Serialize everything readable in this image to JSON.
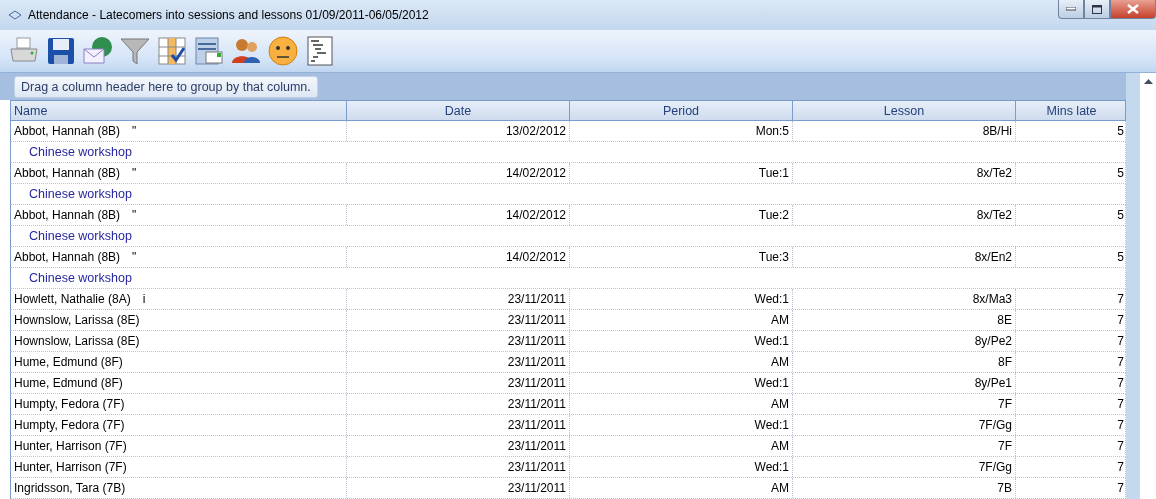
{
  "window": {
    "title": "Attendance - Latecomers into sessions and lessons 01/09/2011-06/05/2012"
  },
  "toolbar": [
    {
      "kind": "printer"
    },
    {
      "kind": "save"
    },
    {
      "kind": "email"
    },
    {
      "kind": "filter"
    },
    {
      "kind": "columns"
    },
    {
      "kind": "export"
    },
    {
      "kind": "people"
    },
    {
      "kind": "face"
    },
    {
      "kind": "report"
    }
  ],
  "group_panel": {
    "hint": "Drag a column header here to group by that column."
  },
  "table": {
    "columns": [
      "Name",
      "Date",
      "Period",
      "Lesson",
      "Mins late"
    ],
    "rows": [
      {
        "name": "Abbot, Hannah (8B)",
        "mark": "\"",
        "date": "13/02/2012",
        "period": "Mon:5",
        "lesson": "8B/Hi",
        "mins": "5",
        "note": "Chinese workshop"
      },
      {
        "name": "Abbot, Hannah (8B)",
        "mark": "\"",
        "date": "14/02/2012",
        "period": "Tue:1",
        "lesson": "8x/Te2",
        "mins": "5",
        "note": "Chinese workshop"
      },
      {
        "name": "Abbot, Hannah (8B)",
        "mark": "\"",
        "date": "14/02/2012",
        "period": "Tue:2",
        "lesson": "8x/Te2",
        "mins": "5",
        "note": "Chinese workshop"
      },
      {
        "name": "Abbot, Hannah (8B)",
        "mark": "\"",
        "date": "14/02/2012",
        "period": "Tue:3",
        "lesson": "8x/En2",
        "mins": "5",
        "note": "Chinese workshop"
      },
      {
        "name": "Howlett, Nathalie (8A)",
        "mark": "i",
        "date": "23/11/2011",
        "period": "Wed:1",
        "lesson": "8x/Ma3",
        "mins": "7"
      },
      {
        "name": "Hownslow, Larissa (8E)",
        "date": "23/11/2011",
        "period": "AM",
        "lesson": "8E",
        "mins": "7"
      },
      {
        "name": "Hownslow, Larissa (8E)",
        "date": "23/11/2011",
        "period": "Wed:1",
        "lesson": "8y/Pe2",
        "mins": "7"
      },
      {
        "name": "Hume, Edmund (8F)",
        "date": "23/11/2011",
        "period": "AM",
        "lesson": "8F",
        "mins": "7"
      },
      {
        "name": "Hume, Edmund (8F)",
        "date": "23/11/2011",
        "period": "Wed:1",
        "lesson": "8y/Pe1",
        "mins": "7"
      },
      {
        "name": "Humpty, Fedora (7F)",
        "date": "23/11/2011",
        "period": "AM",
        "lesson": "7F",
        "mins": "7"
      },
      {
        "name": "Humpty, Fedora (7F)",
        "date": "23/11/2011",
        "period": "Wed:1",
        "lesson": "7F/Gg",
        "mins": "7"
      },
      {
        "name": "Hunter, Harrison (7F)",
        "date": "23/11/2011",
        "period": "AM",
        "lesson": "7F",
        "mins": "7"
      },
      {
        "name": "Hunter, Harrison (7F)",
        "date": "23/11/2011",
        "period": "Wed:1",
        "lesson": "7F/Gg",
        "mins": "7"
      },
      {
        "name": "Ingridsson, Tara (7B)",
        "date": "23/11/2011",
        "period": "AM",
        "lesson": "7B",
        "mins": "7"
      }
    ]
  }
}
